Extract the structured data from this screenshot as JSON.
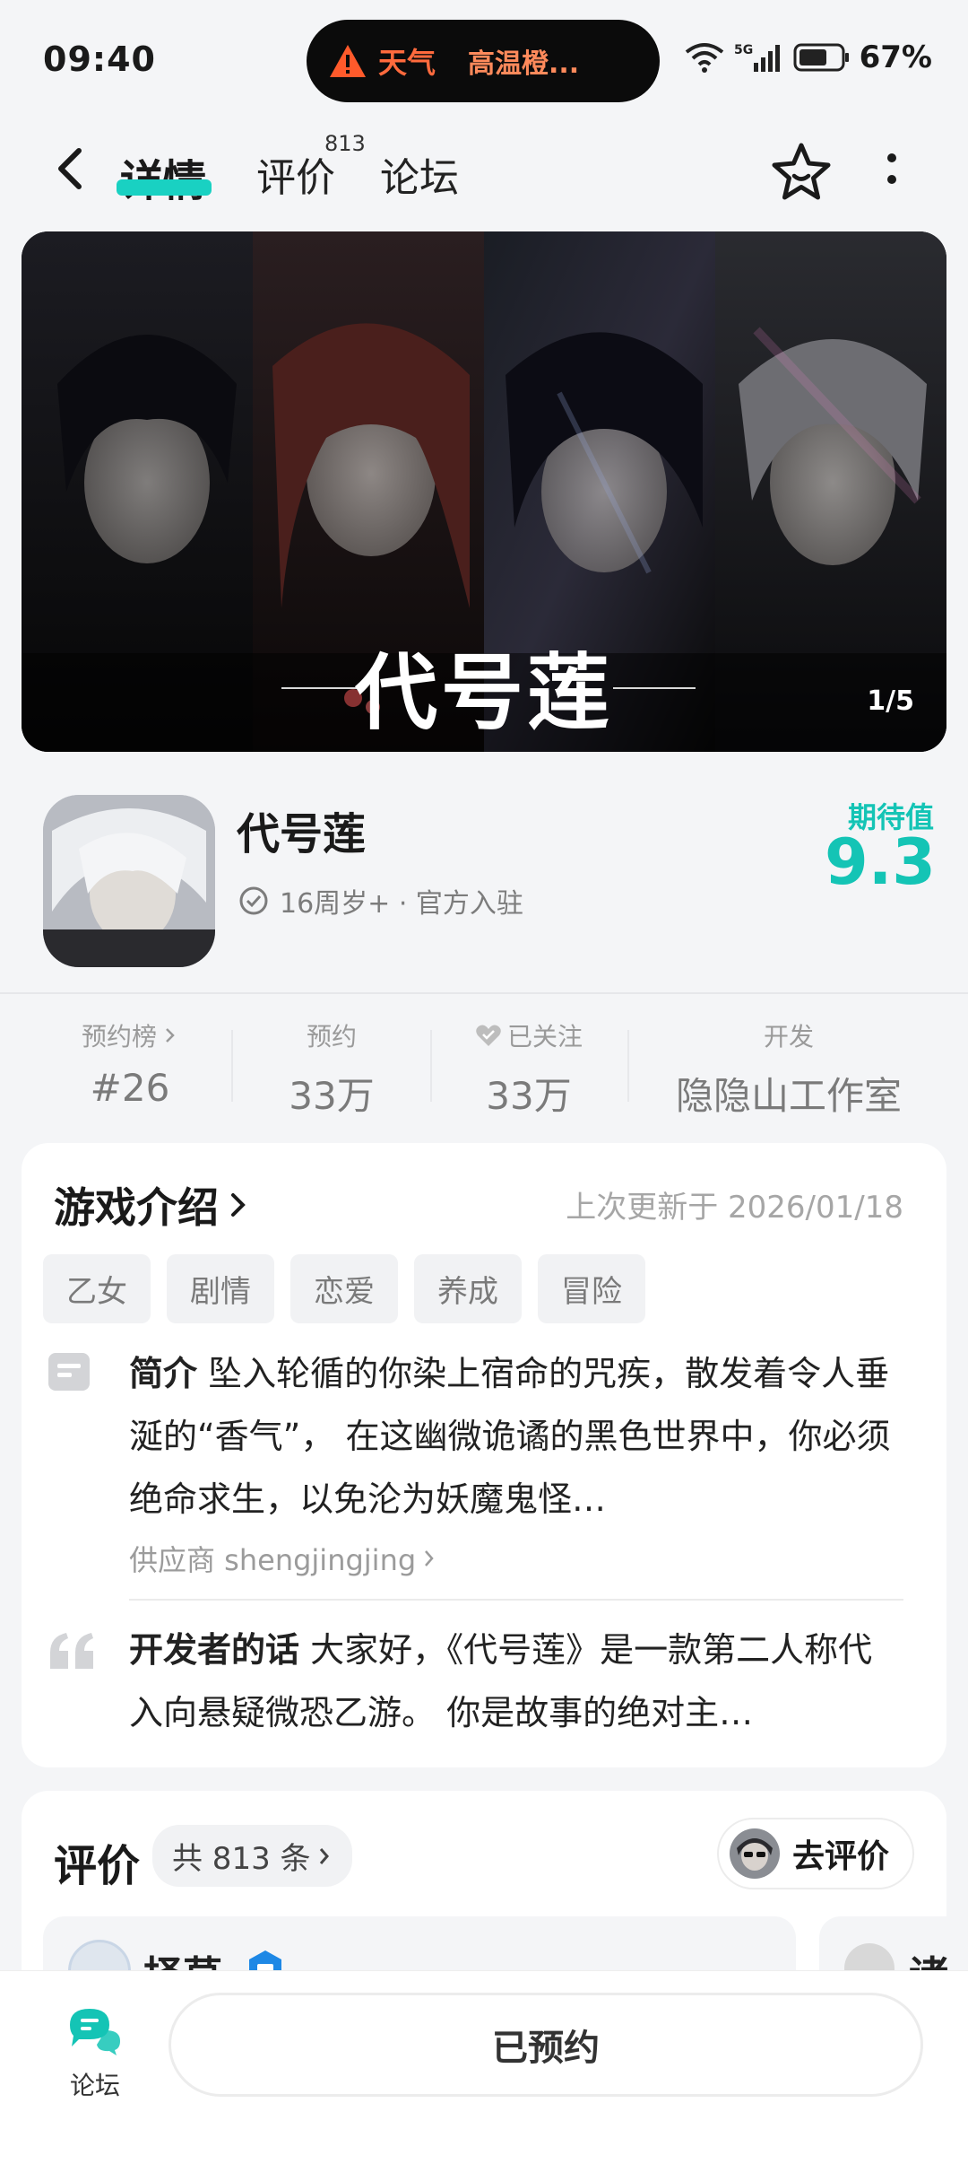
{
  "status_bar": {
    "time": "09:40",
    "island_label": "天气",
    "island_text": "高温橙...",
    "network": "5G",
    "battery": "67%"
  },
  "nav": {
    "tab_detail": "详情",
    "tab_review": "评价",
    "tab_review_count": "813",
    "tab_forum": "论坛"
  },
  "banner": {
    "title": "代号莲",
    "counter": "1/5"
  },
  "game": {
    "name": "代号莲",
    "age_rating": "16周岁+ · 官方入驻",
    "expect_label": "期待值",
    "expect_score": "9.3"
  },
  "stats": [
    {
      "label": "预约榜",
      "value": "#26"
    },
    {
      "label": "预约",
      "value": "33万"
    },
    {
      "label": "已关注",
      "value": "33万"
    },
    {
      "label": "开发",
      "value": "隐隐山工作室"
    }
  ],
  "intro": {
    "title": "游戏介绍",
    "updated": "上次更新于 2026/01/18",
    "tags": [
      "乙女",
      "剧情",
      "恋爱",
      "养成",
      "冒险"
    ],
    "summary_label": "简介",
    "summary_text": " 坠入轮循的你染上宿命的咒疾，散发着令人垂涎的“香气”， 在这幽微诡谲的黑色世界中，你必须绝命求生，以免沦为妖魔鬼怪…",
    "supplier": "供应商 shengjingjing",
    "dev_label": "开发者的话",
    "dev_text": " 大家好，《代号莲》是一款第二人称代入向悬疑微恐乙游。 你是故事的绝对主…"
  },
  "reviews": {
    "title": "评价",
    "count": "共 813 条",
    "go_review": "去评价",
    "user1": "择草",
    "user2": "诸"
  },
  "bottom": {
    "forum_label": "论坛",
    "reserved_label": "已预约"
  },
  "colors": {
    "accent": "#14c4b5",
    "warning": "#ff6a3d"
  }
}
